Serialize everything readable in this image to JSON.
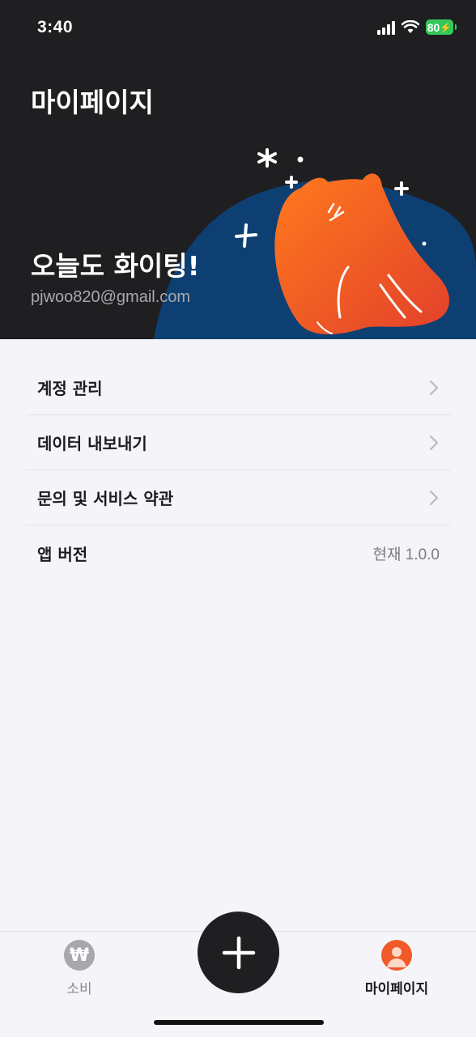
{
  "status_bar": {
    "time": "3:40",
    "battery": "80"
  },
  "header": {
    "title": "마이페이지",
    "greeting": "오늘도 화이팅!",
    "email": "pjwoo820@gmail.com"
  },
  "menu": {
    "items": [
      {
        "label": "계정 관리"
      },
      {
        "label": "데이터 내보내기"
      },
      {
        "label": "문의 및 서비스 약관"
      }
    ],
    "version": {
      "label": "앱 버전",
      "value": "현재 1.0.0"
    }
  },
  "tabbar": {
    "tabs": [
      {
        "label": "소비",
        "icon": "won-icon"
      },
      {
        "label": "마이페이지",
        "icon": "profile-icon"
      }
    ],
    "add_icon": "plus-icon"
  },
  "colors": {
    "header_bg": "#1f1e20",
    "accent_orange": "#f05a28",
    "blob_blue": "#0e3f73",
    "battery_green": "#34c759"
  }
}
